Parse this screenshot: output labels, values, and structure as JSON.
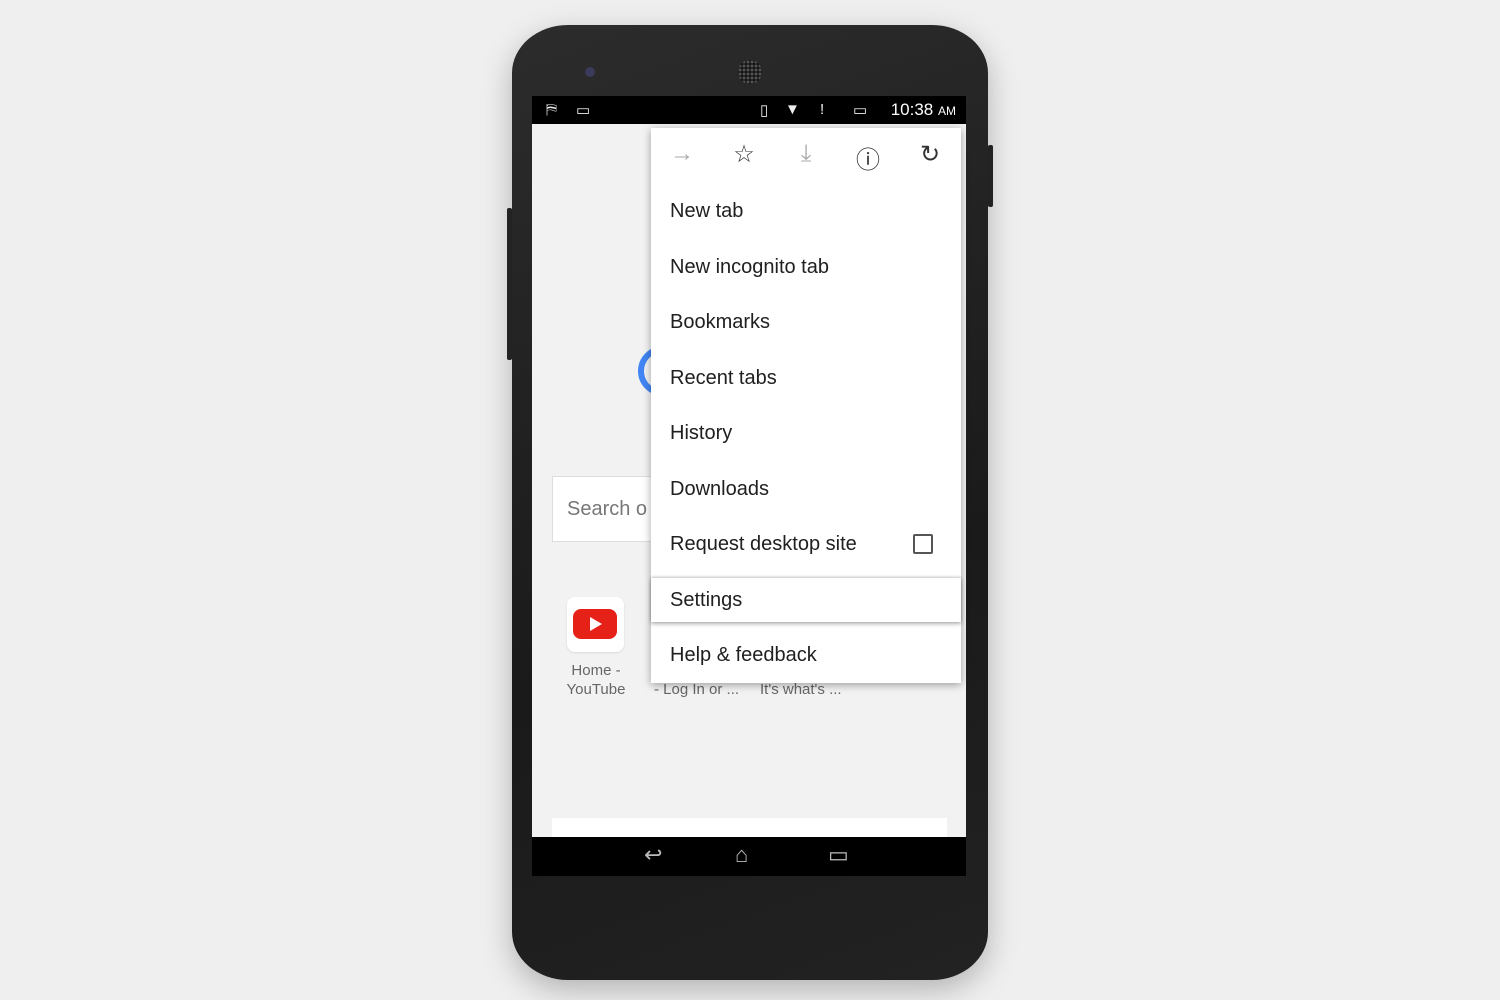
{
  "status_bar": {
    "time": "10:38",
    "ampm": "AM",
    "icons": [
      "cleaner-icon",
      "image-icon",
      "vibrate-icon",
      "wifi-icon",
      "alert-icon",
      "battery-icon"
    ]
  },
  "page": {
    "search_placeholder": "Search o",
    "tiles": [
      {
        "label1": "Home -",
        "label2": "YouTube"
      },
      {
        "label": "- Log In or ..."
      },
      {
        "label": "It's what's ..."
      }
    ]
  },
  "menu": {
    "toolbar": [
      "forward-icon",
      "bookmark-star-icon",
      "download-icon",
      "info-icon",
      "reload-icon"
    ],
    "items": [
      {
        "label": "New tab"
      },
      {
        "label": "New incognito tab"
      },
      {
        "label": "Bookmarks"
      },
      {
        "label": "Recent tabs"
      },
      {
        "label": "History"
      },
      {
        "label": "Downloads"
      },
      {
        "label": "Request desktop site",
        "checked": false
      },
      {
        "label": "Settings",
        "highlighted": true
      },
      {
        "label": "Help & feedback"
      }
    ]
  },
  "nav": [
    "back-icon",
    "home-icon",
    "recents-icon"
  ]
}
